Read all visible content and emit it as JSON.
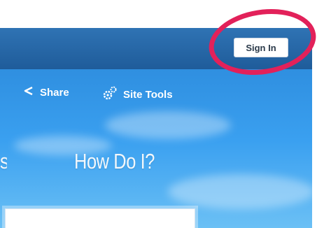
{
  "header": {
    "sign_in_label": "Sign In"
  },
  "toolbar": {
    "share_label": "Share",
    "site_tools_label": "Site Tools",
    "share_icon": "share-icon",
    "site_tools_icon": "gear-icon"
  },
  "nav": {
    "partial_label": "s",
    "how_do_i_label": "How Do I?"
  },
  "colors": {
    "topbar": "#2f73b4",
    "hero_sky": "#3aa0f0",
    "annotation_circle": "#e2215a"
  }
}
